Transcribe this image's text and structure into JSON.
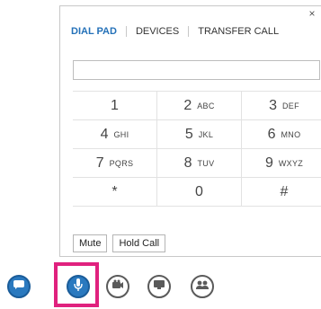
{
  "tabs": [
    {
      "label": "DIAL PAD",
      "active": true
    },
    {
      "label": "DEVICES",
      "active": false
    },
    {
      "label": "TRANSFER CALL",
      "active": false
    }
  ],
  "close_label": "×",
  "number_input": {
    "value": "",
    "placeholder": ""
  },
  "keypad": [
    [
      {
        "digit": "1",
        "letters": ""
      },
      {
        "digit": "2",
        "letters": "ABC"
      },
      {
        "digit": "3",
        "letters": "DEF"
      }
    ],
    [
      {
        "digit": "4",
        "letters": "GHI"
      },
      {
        "digit": "5",
        "letters": "JKL"
      },
      {
        "digit": "6",
        "letters": "MNO"
      }
    ],
    [
      {
        "digit": "7",
        "letters": "PQRS"
      },
      {
        "digit": "8",
        "letters": "TUV"
      },
      {
        "digit": "9",
        "letters": "WXYZ"
      }
    ],
    [
      {
        "digit": "*",
        "letters": ""
      },
      {
        "digit": "0",
        "letters": ""
      },
      {
        "digit": "#",
        "letters": ""
      }
    ]
  ],
  "call_buttons": {
    "mute": "Mute",
    "hold": "Hold Call"
  },
  "bottom_icons": [
    {
      "name": "im-icon",
      "style": "blue"
    },
    {
      "name": "microphone-icon",
      "style": "blue"
    },
    {
      "name": "video-camera-icon",
      "style": "grey"
    },
    {
      "name": "presentation-icon",
      "style": "grey"
    },
    {
      "name": "participants-icon",
      "style": "grey"
    }
  ],
  "colors": {
    "accent": "#2471b8",
    "icon_blue": "#2a79bf",
    "highlight": "#e0217e",
    "icon_grey": "#5a5a5a"
  }
}
